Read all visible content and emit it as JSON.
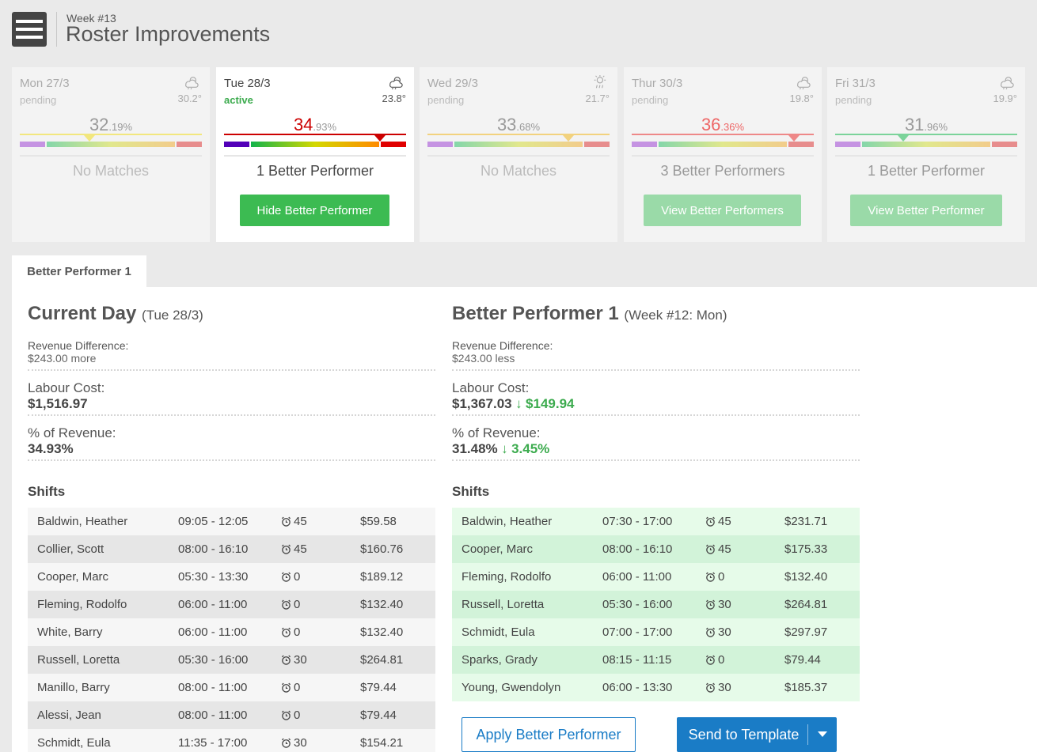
{
  "header": {
    "week": "Week #13",
    "title": "Roster Improvements"
  },
  "days": [
    {
      "name": "Mon 27/3",
      "status": "pending",
      "temp": "30.2°",
      "pct_main": "32",
      "pct_dec": ".19%",
      "summary": "No Matches",
      "button": ""
    },
    {
      "name": "Tue 28/3",
      "status": "active",
      "temp": "23.8°",
      "pct_main": "34",
      "pct_dec": ".93%",
      "summary": "1 Better Performer",
      "button": "Hide Better Performer"
    },
    {
      "name": "Wed 29/3",
      "status": "pending",
      "temp": "21.7°",
      "pct_main": "33",
      "pct_dec": ".68%",
      "summary": "No Matches",
      "button": ""
    },
    {
      "name": "Thur 30/3",
      "status": "pending",
      "temp": "19.8°",
      "pct_main": "36",
      "pct_dec": ".36%",
      "summary": "3 Better Performers",
      "button": "View Better Performers"
    },
    {
      "name": "Fri 31/3",
      "status": "pending",
      "temp": "19.9°",
      "pct_main": "31",
      "pct_dec": ".96%",
      "summary": "1 Better Performer",
      "button": "View Better Performer"
    }
  ],
  "colors": {
    "accent_green": "#3cbb52",
    "accent_blue": "#1a7cc6",
    "danger_red": "#cc0000"
  },
  "tab": {
    "label": "Better Performer 1"
  },
  "current": {
    "title": "Current Day",
    "subtitle": "(Tue 28/3)",
    "revenue_label": "Revenue Difference:",
    "revenue_value": "$243.00 more",
    "labour_label": "Labour Cost:",
    "labour_value": "$1,516.97",
    "pct_label": "% of Revenue:",
    "pct_value": "34.93%",
    "shifts_label": "Shifts",
    "shifts": [
      {
        "name": "Baldwin, Heather",
        "time": "09:05 - 12:05",
        "break": "45",
        "cost": "$59.58"
      },
      {
        "name": "Collier, Scott",
        "time": "08:00 - 16:10",
        "break": "45",
        "cost": "$160.76"
      },
      {
        "name": "Cooper, Marc",
        "time": "05:30 - 13:30",
        "break": "0",
        "cost": "$189.12"
      },
      {
        "name": "Fleming, Rodolfo",
        "time": "06:00 - 11:00",
        "break": "0",
        "cost": "$132.40"
      },
      {
        "name": "White, Barry",
        "time": "06:00 - 11:00",
        "break": "0",
        "cost": "$132.40"
      },
      {
        "name": "Russell, Loretta",
        "time": "05:30 - 16:00",
        "break": "30",
        "cost": "$264.81"
      },
      {
        "name": "Manillo, Barry",
        "time": "08:00 - 11:00",
        "break": "0",
        "cost": "$79.44"
      },
      {
        "name": "Alessi, Jean",
        "time": "08:00 - 11:00",
        "break": "0",
        "cost": "$79.44"
      },
      {
        "name": "Schmidt, Eula",
        "time": "11:35 - 17:00",
        "break": "30",
        "cost": "$154.21"
      }
    ]
  },
  "better": {
    "title": "Better Performer 1",
    "subtitle": "(Week #12: Mon)",
    "revenue_label": "Revenue Difference:",
    "revenue_value": "$243.00 less",
    "labour_label": "Labour Cost:",
    "labour_value": "$1,367.03",
    "labour_diff": "$149.94",
    "pct_label": "% of Revenue:",
    "pct_value": "31.48%",
    "pct_diff": "3.45%",
    "shifts_label": "Shifts",
    "shifts": [
      {
        "name": "Baldwin, Heather",
        "time": "07:30 - 17:00",
        "break": "45",
        "cost": "$231.71"
      },
      {
        "name": "Cooper, Marc",
        "time": "08:00 - 16:10",
        "break": "45",
        "cost": "$175.33"
      },
      {
        "name": "Fleming, Rodolfo",
        "time": "06:00 - 11:00",
        "break": "0",
        "cost": "$132.40"
      },
      {
        "name": "Russell, Loretta",
        "time": "05:30 - 16:00",
        "break": "30",
        "cost": "$264.81"
      },
      {
        "name": "Schmidt, Eula",
        "time": "07:00 - 17:00",
        "break": "30",
        "cost": "$297.97"
      },
      {
        "name": "Sparks, Grady",
        "time": "08:15 - 11:15",
        "break": "0",
        "cost": "$79.44"
      },
      {
        "name": "Young, Gwendolyn",
        "time": "06:00 - 13:30",
        "break": "30",
        "cost": "$185.37"
      }
    ]
  },
  "actions": {
    "apply": "Apply Better Performer",
    "send": "Send to Template"
  }
}
